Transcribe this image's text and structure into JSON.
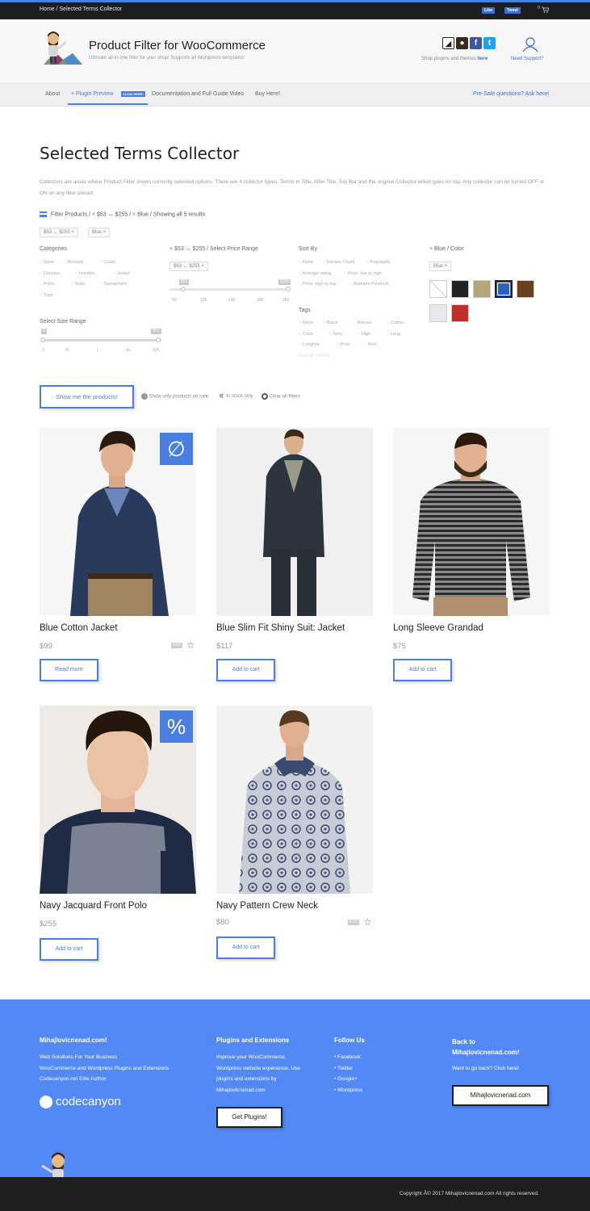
{
  "topbar": {
    "breadcrumb": "Home / Selected Terms Collector",
    "like_label": "Like",
    "tweet_label": "Tweet",
    "cart_count": "0"
  },
  "header": {
    "title": "Product Filter for WooCommerce",
    "tagline": "Ultimate all-in-one filter for your shop! Supports all Wordpress templates!",
    "shop_text": "Shop plugins and themes",
    "shop_link": "here",
    "support_label": "Need Support?"
  },
  "nav": {
    "items": [
      "About",
      "Plugin Preview",
      "Documentation and Full Guide Video",
      "Buy Here!"
    ],
    "badge": "CLICK HERE!",
    "presale": "Pre-Sale questions? Ask here!"
  },
  "main": {
    "title": "Selected Terms Collector",
    "intro": "Collectors are areas where Product Filter shows currently selected options. There are 4 collector types. Terms In Title, After Title, Top Bar and the original Collector which goes on top. Any collector can be turned OFF or ON on any filter preset!",
    "collector": {
      "label": "Filter Products",
      "price": "$53 ↔ $255",
      "color": "Blue",
      "results": "Showing all 5 results",
      "chips": [
        "$53 ↔ $255",
        "Blue"
      ]
    },
    "filters": {
      "categories": {
        "title": "Categories",
        "options": [
          "None",
          "Blouses",
          "Coats",
          "Dresses",
          "Hoodies",
          "Jacket",
          "Polos",
          "Suits",
          "Sweatshirts",
          "Tops"
        ]
      },
      "price_range": {
        "title": "$53 ↔ $255 / Select Price Range",
        "chip": "$63 ↔ $255",
        "min_label": "$63",
        "max_label": "$255",
        "ticks": [
          "60",
          "100",
          "140",
          "180",
          "260"
        ]
      },
      "sort_by": {
        "title": "Sort By",
        "options": [
          "None",
          "Review Count",
          "Popularity",
          "Average rating",
          "Price: low to high",
          "Price: high to low",
          "Random Products"
        ]
      },
      "color": {
        "title": "Blue / Color",
        "chip": "Blue",
        "swatches": [
          "#ffffff",
          "#222222",
          "#b5a57f",
          "#2f5fbf",
          "#6b4020",
          "#e8e8ee",
          "#c0302a"
        ]
      },
      "size": {
        "title": "Select Size Range",
        "min_label": "S",
        "max_label": "XXL",
        "ticks": [
          "S",
          "M",
          "L",
          "XL",
          "XXL"
        ]
      },
      "tags": {
        "title": "Tags",
        "options": [
          "None",
          "Black",
          "Blouse",
          "Cotton",
          "Crew",
          "Grey",
          "High",
          "Long",
          "Longline",
          "Print",
          "Red"
        ],
        "show_more": "SHOW MORE"
      }
    },
    "actions": {
      "show_button": "Show me the products!",
      "on_sale": "Show only products on sale",
      "in_stock": "In stock only",
      "clear": "Clear all filters"
    },
    "products": [
      {
        "name": "Blue Cotton Jacket",
        "price": "$99",
        "button": "Read more",
        "corner": "∅",
        "rating": "5.00"
      },
      {
        "name": "Blue Slim Fit Shiny Suit: Jacket",
        "price": "$117",
        "button": "Add to cart"
      },
      {
        "name": "Long Sleeve Grandad",
        "price": "$75",
        "button": "Add to cart"
      },
      {
        "name": "Navy Jacquard Front Polo",
        "price": "$255",
        "button": "Add to cart",
        "corner": "%"
      },
      {
        "name": "Navy Pattern Crew Neck",
        "price": "$80",
        "button": "Add to cart",
        "rating": "4.00"
      }
    ]
  },
  "footer": {
    "col1": {
      "title": "Mihajlovicnenad.com!",
      "lines": [
        "Web Solutions For Your Business",
        "WooCommerce and Wordpress Plugins and Extensions",
        "Codecanyon.net Elite Author"
      ],
      "logo": "codecanyon"
    },
    "col2": {
      "title": "Plugins and Extensions",
      "lines": [
        "Improve your WooCommerce,",
        "Wordpress website experience. Use",
        "plugins and extensions by",
        "Mihajlovicnenad.com"
      ],
      "button": "Get Plugins!"
    },
    "col3": {
      "title": "Follow Us",
      "links": [
        "Facebook",
        "Twitter",
        "Google+",
        "Wordpress"
      ]
    },
    "col4": {
      "title_line1": "Back to",
      "title_line2": "Mihajlovicnenad.com!",
      "text": "Want to go back? Click here!",
      "button": "Mihajlovicnenad.com"
    },
    "copyright": "Copyright Â© 2017 Mihajlovicnenad.com All rights reserved."
  }
}
